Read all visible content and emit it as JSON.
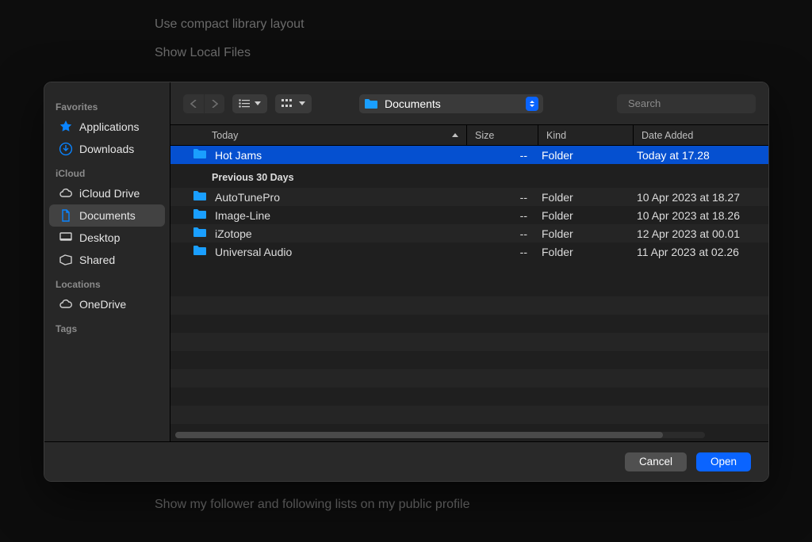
{
  "background": {
    "row1": "Use compact library layout",
    "row2": "Show Local Files",
    "row3": "Show my follower and following lists on my public profile"
  },
  "sidebar": {
    "sections": [
      {
        "title": "Favorites",
        "items": [
          {
            "icon": "apps-icon",
            "label": "Applications"
          },
          {
            "icon": "download-icon",
            "label": "Downloads"
          }
        ]
      },
      {
        "title": "iCloud",
        "items": [
          {
            "icon": "cloud-icon",
            "label": "iCloud Drive"
          },
          {
            "icon": "doc-icon",
            "label": "Documents",
            "selected": true
          },
          {
            "icon": "desktop-icon",
            "label": "Desktop"
          },
          {
            "icon": "shared-icon",
            "label": "Shared"
          }
        ]
      },
      {
        "title": "Locations",
        "items": [
          {
            "icon": "cloud-icon",
            "label": "OneDrive"
          }
        ]
      },
      {
        "title": "Tags",
        "items": []
      }
    ]
  },
  "toolbar": {
    "path_label": "Documents",
    "search_placeholder": "Search"
  },
  "columns": {
    "name": "Today",
    "size": "Size",
    "kind": "Kind",
    "date": "Date Added"
  },
  "groups": [
    {
      "label": "Today",
      "hide_label": true,
      "rows": [
        {
          "name": "Hot Jams",
          "size": "--",
          "kind": "Folder",
          "date": "Today at 17.28",
          "selected": true
        }
      ]
    },
    {
      "label": "Previous 30 Days",
      "rows": [
        {
          "name": "AutoTunePro",
          "size": "--",
          "kind": "Folder",
          "date": "10 Apr 2023 at 18.27"
        },
        {
          "name": "Image-Line",
          "size": "--",
          "kind": "Folder",
          "date": "10 Apr 2023 at 18.26"
        },
        {
          "name": "iZotope",
          "size": "--",
          "kind": "Folder",
          "date": "12 Apr 2023 at 00.01"
        },
        {
          "name": "Universal Audio",
          "size": "--",
          "kind": "Folder",
          "date": "11 Apr 2023 at 02.26"
        }
      ]
    }
  ],
  "footer": {
    "cancel": "Cancel",
    "open": "Open"
  }
}
